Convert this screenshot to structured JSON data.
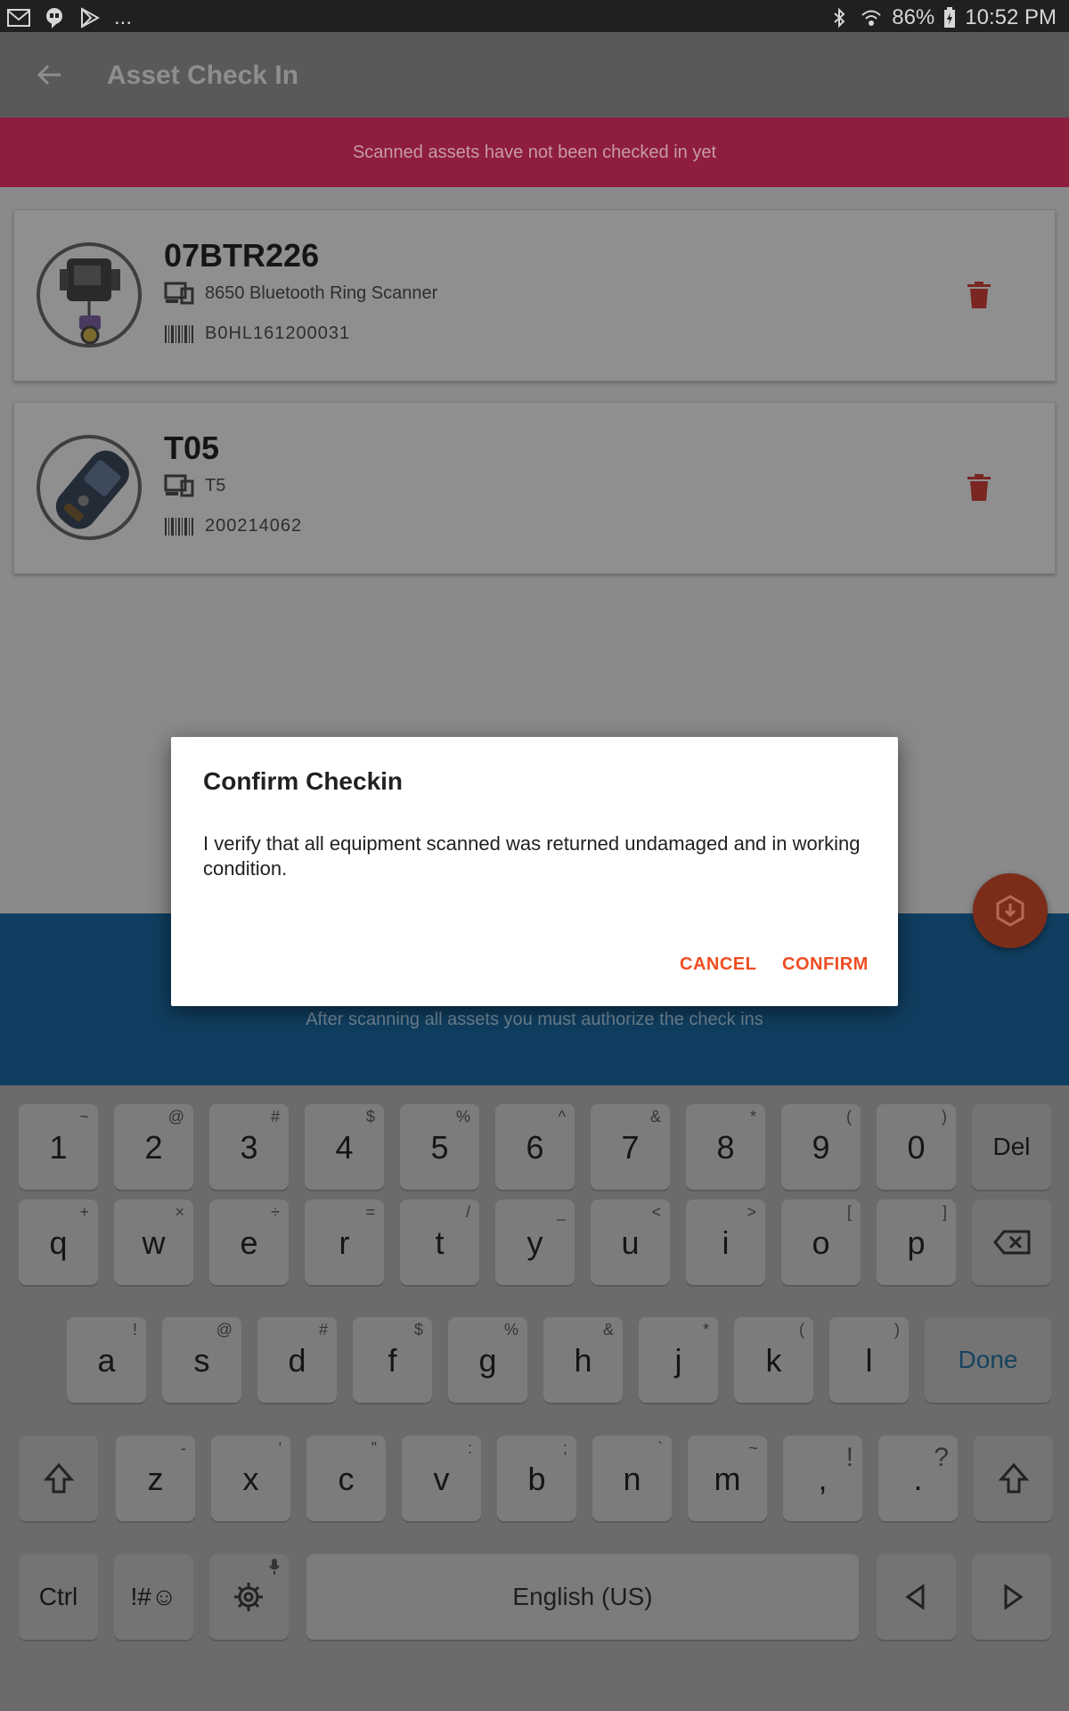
{
  "status_bar": {
    "left_icons": [
      "gmail-icon",
      "hangouts-icon",
      "play-store-icon"
    ],
    "overflow": "...",
    "battery": "86%",
    "time": "10:52 PM"
  },
  "app_bar": {
    "title": "Asset Check In"
  },
  "banner": {
    "text": "Scanned assets have not been checked in yet"
  },
  "assets": [
    {
      "name": "07BTR226",
      "model": "8650 Bluetooth Ring Scanner",
      "serial": "B0HL161200031"
    },
    {
      "name": "T05",
      "model": "T5",
      "serial": "200214062"
    }
  ],
  "bottom": {
    "text": "After scanning all assets you must authorize the check ins"
  },
  "dialog": {
    "title": "Confirm Checkin",
    "body": "I verify that all equipment scanned was returned undamaged and in working condition.",
    "cancel": "CANCEL",
    "confirm": "CONFIRM"
  },
  "keyboard": {
    "row1": [
      {
        "k": "1",
        "a": "~"
      },
      {
        "k": "2",
        "a": "@"
      },
      {
        "k": "3",
        "a": "#"
      },
      {
        "k": "4",
        "a": "$"
      },
      {
        "k": "5",
        "a": "%"
      },
      {
        "k": "6",
        "a": "^"
      },
      {
        "k": "7",
        "a": "&"
      },
      {
        "k": "8",
        "a": "*"
      },
      {
        "k": "9",
        "a": "("
      },
      {
        "k": "0",
        "a": ")"
      }
    ],
    "del": "Del",
    "row2": [
      {
        "k": "q",
        "a": "+"
      },
      {
        "k": "w",
        "a": "×"
      },
      {
        "k": "e",
        "a": "÷"
      },
      {
        "k": "r",
        "a": "="
      },
      {
        "k": "t",
        "a": "/"
      },
      {
        "k": "y",
        "a": "_"
      },
      {
        "k": "u",
        "a": "<"
      },
      {
        "k": "i",
        "a": ">"
      },
      {
        "k": "o",
        "a": "["
      },
      {
        "k": "p",
        "a": "]"
      }
    ],
    "row3": [
      {
        "k": "a",
        "a": "!"
      },
      {
        "k": "s",
        "a": "@"
      },
      {
        "k": "d",
        "a": "#"
      },
      {
        "k": "f",
        "a": "$"
      },
      {
        "k": "g",
        "a": "%"
      },
      {
        "k": "h",
        "a": "&"
      },
      {
        "k": "j",
        "a": "*"
      },
      {
        "k": "k",
        "a": "("
      },
      {
        "k": "l",
        "a": ")"
      }
    ],
    "done": "Done",
    "row4": [
      {
        "k": "z",
        "a": "-"
      },
      {
        "k": "x",
        "a": "'"
      },
      {
        "k": "c",
        "a": "\""
      },
      {
        "k": "v",
        "a": ":"
      },
      {
        "k": "b",
        "a": ";"
      },
      {
        "k": "n",
        "a": "`"
      },
      {
        "k": "m",
        "a": "~"
      },
      {
        "k": ",",
        "a": "!"
      },
      {
        "k": ".",
        "a": "?"
      }
    ],
    "ctrl": "Ctrl",
    "symbols": "!#☺",
    "space": "English (US)"
  },
  "colors": {
    "banner": "#8e1d3e",
    "accent": "#ef4e23",
    "bottom_panel": "#103e60"
  }
}
